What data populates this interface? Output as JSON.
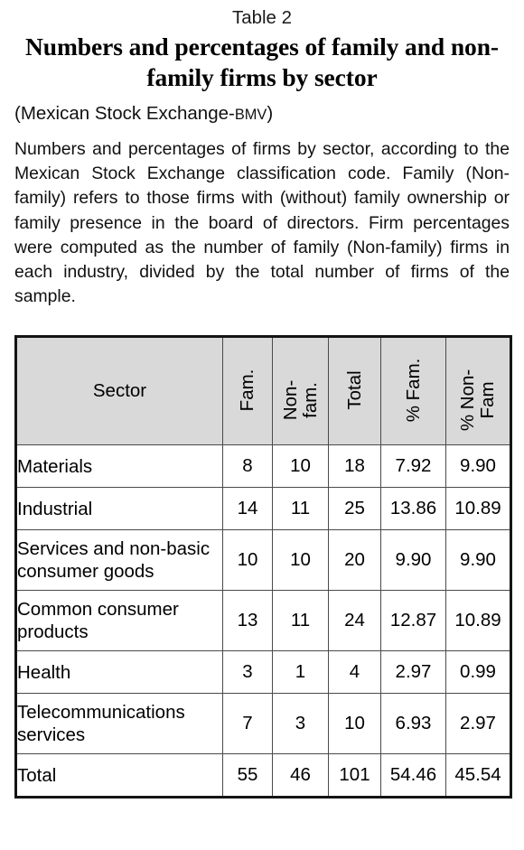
{
  "caption": {
    "table_number": "Table 2",
    "title": "Numbers and percentages of family and non-family firms by sector",
    "subtitle_prefix": "(Mexican Stock Exchange-",
    "subtitle_acronym": "BMV",
    "subtitle_suffix": ")",
    "note": "Numbers and percentages of firms by sector, according to the Mexican Stock Exchange classification code. Family (Non-family) refers to those firms with (without) family ownership or family presence in the board of directors. Firm percentages were computed as the number of family (Non-family) firms in each industry, divided by the total number of firms of the sample."
  },
  "table": {
    "headers": {
      "sector": "Sector",
      "fam": "Fam.",
      "nonfam": "Non-\nfam.",
      "total": "Total",
      "pct_fam": "% Fam.",
      "pct_nonfam": "% Non-\nFam"
    },
    "header_fill": "#d9d9d9",
    "border_color": "#141414",
    "rows": [
      {
        "sector": "Materials",
        "fam": "8",
        "nonfam": "10",
        "total": "18",
        "pct_fam": "7.92",
        "pct_nonfam": "9.90",
        "lines": 1
      },
      {
        "sector": "Industrial",
        "fam": "14",
        "nonfam": "11",
        "total": "25",
        "pct_fam": "13.86",
        "pct_nonfam": "10.89",
        "lines": 1
      },
      {
        "sector": "Services and non-basic consumer goods",
        "fam": "10",
        "nonfam": "10",
        "total": "20",
        "pct_fam": "9.90",
        "pct_nonfam": "9.90",
        "lines": 2
      },
      {
        "sector": "Common consumer products",
        "fam": "13",
        "nonfam": "11",
        "total": "24",
        "pct_fam": "12.87",
        "pct_nonfam": "10.89",
        "lines": 2
      },
      {
        "sector": "Health",
        "fam": "3",
        "nonfam": "1",
        "total": "4",
        "pct_fam": "2.97",
        "pct_nonfam": "0.99",
        "lines": 1
      },
      {
        "sector": "Telecommunications services",
        "fam": "7",
        "nonfam": "3",
        "total": "10",
        "pct_fam": "6.93",
        "pct_nonfam": "2.97",
        "lines": 2
      },
      {
        "sector": "Total",
        "fam": "55",
        "nonfam": "46",
        "total": "101",
        "pct_fam": "54.46",
        "pct_nonfam": "45.54",
        "lines": 1
      }
    ]
  }
}
